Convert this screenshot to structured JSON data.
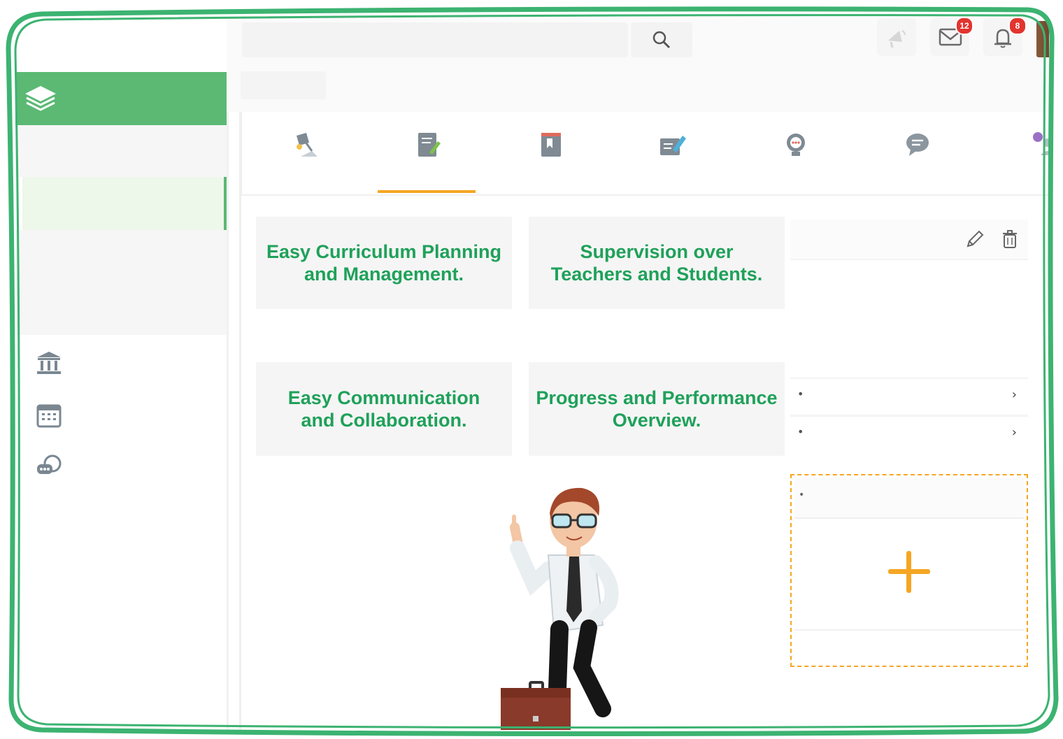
{
  "topbar": {
    "search_icon": "search-icon",
    "announce_icon": "megaphone-icon",
    "messages": {
      "icon": "envelope-icon",
      "badge": "12"
    },
    "notifications": {
      "icon": "bell-icon",
      "badge": "8"
    }
  },
  "sidebar": {
    "brand_icon": "layers-icon",
    "items": [
      {
        "icon": "institution-icon"
      },
      {
        "icon": "calendar-icon"
      },
      {
        "icon": "chat-bubble-icon"
      }
    ]
  },
  "tabs": [
    {
      "icon": "lamp-icon"
    },
    {
      "icon": "notebook-pencil-icon",
      "active": true
    },
    {
      "icon": "book-icon"
    },
    {
      "icon": "edit-form-icon"
    },
    {
      "icon": "mentor-chat-icon"
    },
    {
      "icon": "comment-icon"
    },
    {
      "icon": "group-chat-icon"
    }
  ],
  "features": {
    "card1": {
      "line1": "Easy Curriculum Planning",
      "line2": "and Management."
    },
    "card2": {
      "line1": "Supervision over",
      "line2": "Teachers and Students."
    },
    "card3": {
      "line1": "Easy Communication",
      "line2": "and Collaboration."
    },
    "card4": {
      "line1": "Progress and Performance",
      "line2": "Overview."
    }
  },
  "widget": {
    "edit_icon": "pencil-icon",
    "delete_icon": "trash-icon",
    "rows": [
      {
        "bullet": "•",
        "chevron": "›"
      },
      {
        "bullet": "•",
        "chevron": "›"
      }
    ]
  },
  "add_widget": {
    "bullet": "•",
    "icon": "plus-icon"
  },
  "colors": {
    "brand_green": "#5bb974",
    "text_green": "#1fa15a",
    "accent_orange": "#f5a623",
    "badge_red": "#e2342f",
    "frame_green": "#3cb371"
  }
}
